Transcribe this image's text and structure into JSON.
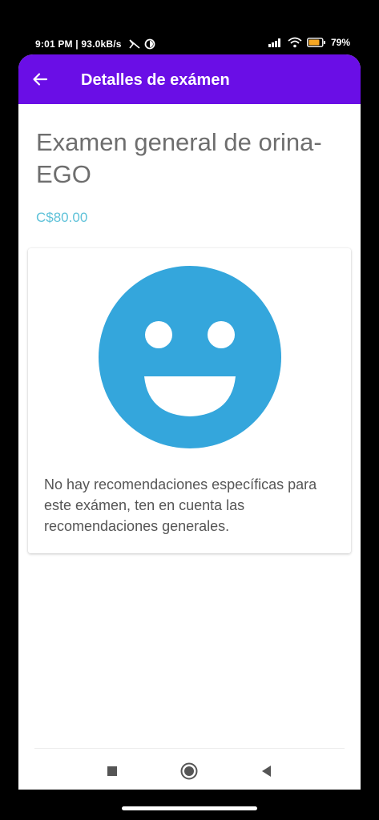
{
  "status_bar": {
    "time_info": "9:01 PM | 93.0kB/s",
    "battery": "79%"
  },
  "app_bar": {
    "title": "Detalles de exámen",
    "color": "#6a0ee6"
  },
  "exam": {
    "title": "Examen general de orina-EGO",
    "price": "C$80.00",
    "price_color": "#5fc2d9"
  },
  "card": {
    "icon": "smiley-face-icon",
    "icon_color": "#34a6dc",
    "message": "No hay recomendaciones específicas para este exámen, ten en cuenta las recomendaciones generales."
  },
  "nav": {
    "icons": [
      "recents-square-icon",
      "home-circle-icon",
      "back-triangle-icon"
    ]
  }
}
